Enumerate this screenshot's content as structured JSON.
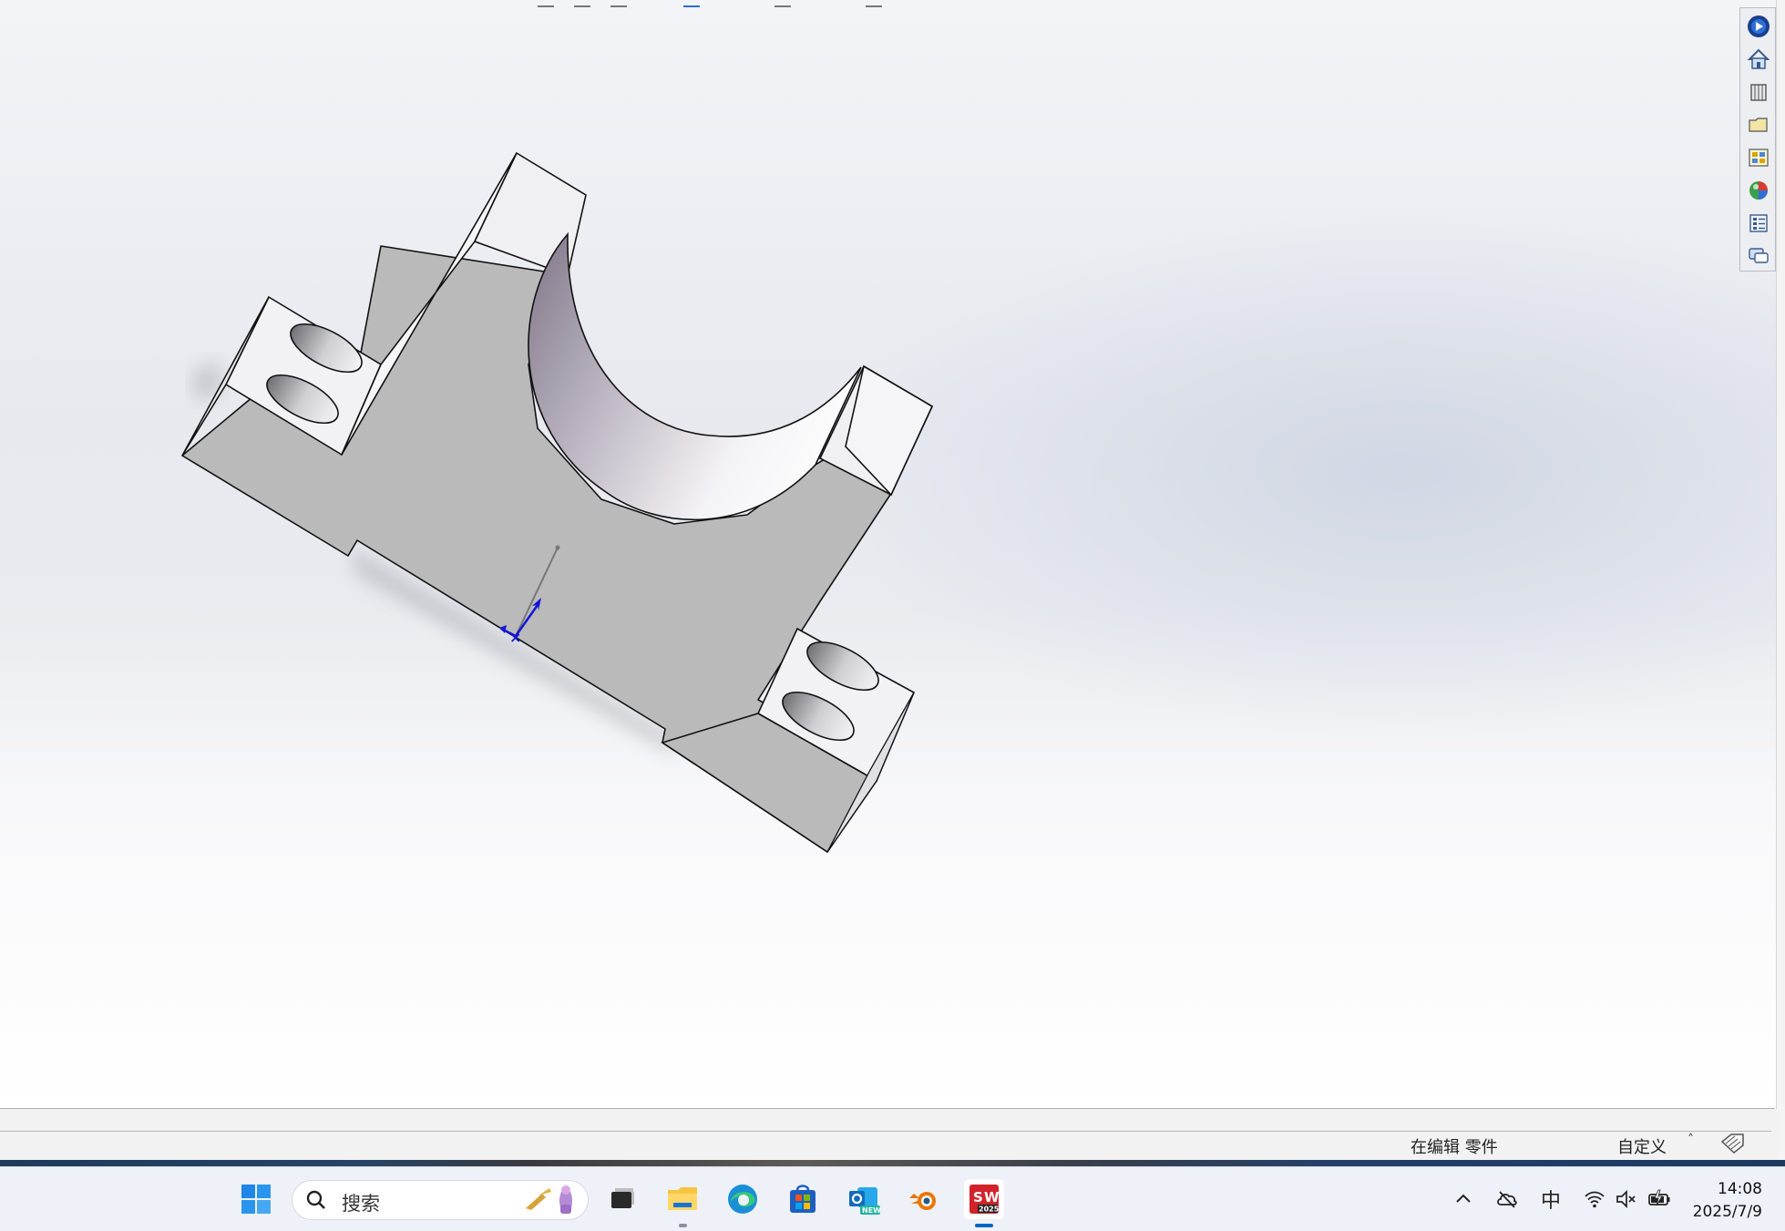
{
  "status_bar": {
    "edit_state": "在编辑 零件",
    "units": "自定义",
    "caret": "˄"
  },
  "task_pane": {
    "buttons": [
      {
        "icon": "solidworks-resources-icon"
      },
      {
        "icon": "home-icon"
      },
      {
        "icon": "design-library-icon"
      },
      {
        "icon": "file-explorer-icon"
      },
      {
        "icon": "view-palette-icon"
      },
      {
        "icon": "appearances-icon"
      },
      {
        "icon": "custom-properties-icon"
      },
      {
        "icon": "forum-icon"
      }
    ]
  },
  "taskbar": {
    "search_placeholder": "搜索",
    "apps": [
      {
        "icon": "windows-start-icon"
      },
      {
        "icon": "task-view-icon"
      },
      {
        "icon": "file-explorer-icon"
      },
      {
        "icon": "edge-browser-icon"
      },
      {
        "icon": "microsoft-store-icon"
      },
      {
        "icon": "outlook-new-icon"
      },
      {
        "icon": "blender-icon"
      },
      {
        "icon": "solidworks-2025-icon"
      }
    ],
    "solidworks_badge": "2025",
    "outlook_badge": "NEW",
    "ime": "中",
    "time": "14:08",
    "date": "2025/7/9"
  },
  "colors": {
    "accent": "#0067c0",
    "solidworks_red": "#d2232a",
    "model_face": "#bababa",
    "model_light": "#f0eff2"
  }
}
